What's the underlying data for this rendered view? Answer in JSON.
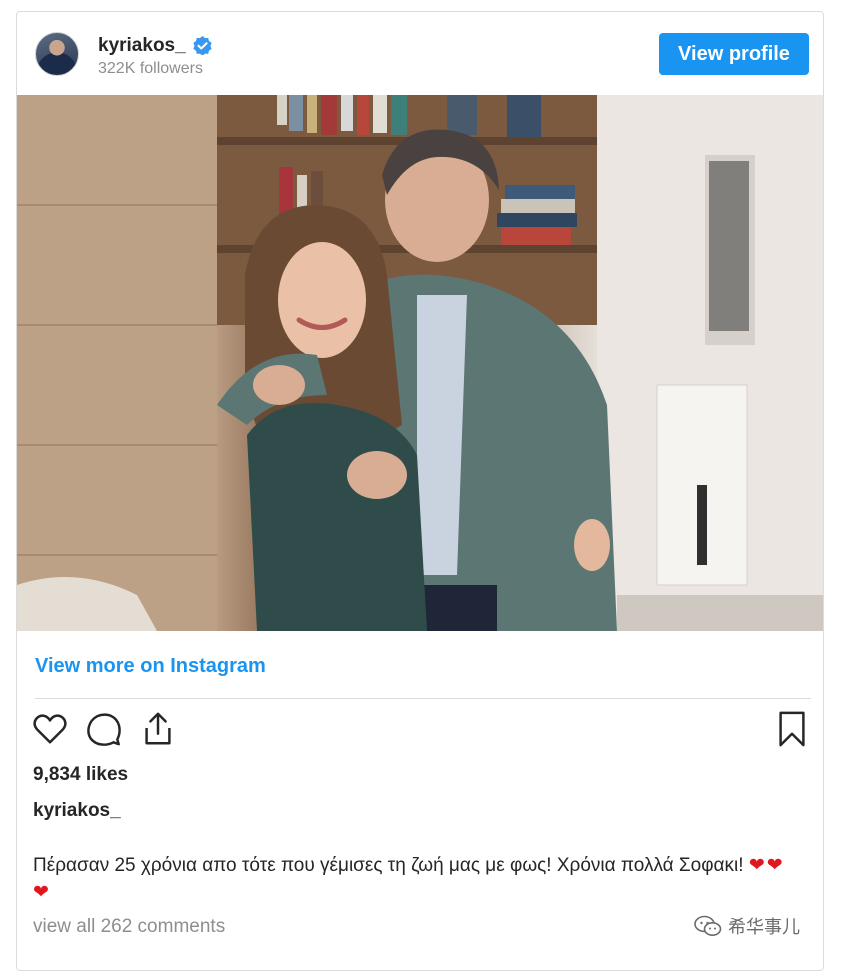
{
  "post": {
    "username": "kyriakos_",
    "followers": "322K followers",
    "view_profile_label": "View profile",
    "view_more_label": "View more on Instagram",
    "likes": "9,834 likes",
    "caption_username": "kyriakos_",
    "caption_text": "Πέρασαν 25 χρόνια απο τότε που γέμισες τη ζωή μας με φως! Χρόνια πολλά Σοφακι!",
    "caption_emoji": "❤❤❤",
    "comments_link": "view all 262 comments"
  },
  "watermark": {
    "text": "希华事儿"
  },
  "colors": {
    "accent": "#1a94f1",
    "verified": "#3897f0",
    "muted": "#8e8e8e",
    "heart": "#e0181e"
  },
  "icons": [
    "verified-badge-icon",
    "heart-icon",
    "comment-icon",
    "share-icon",
    "bookmark-icon",
    "wechat-icon"
  ]
}
